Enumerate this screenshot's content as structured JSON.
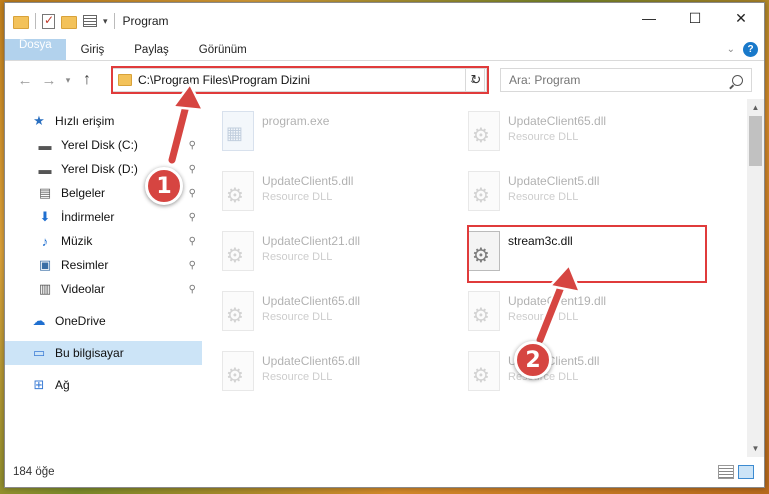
{
  "window": {
    "title": "Program",
    "controls": {
      "minimize": "—",
      "maximize": "☐",
      "close": "✕"
    }
  },
  "ribbon": {
    "tabs": [
      "Dosya",
      "Giriş",
      "Paylaş",
      "Görünüm"
    ],
    "accent": "#1979ca"
  },
  "navigation": {
    "back": "←",
    "forward": "→",
    "up": "↑",
    "address": "C:\\Program Files\\Program Dizini",
    "search_placeholder": "Ara: Program"
  },
  "sidebar": {
    "items": [
      {
        "label": "Hızlı erişim",
        "icon": "star-icon",
        "glyph": "★",
        "pinned": false
      },
      {
        "label": "Yerel Disk (C:)",
        "icon": "drive-icon",
        "glyph": "▬",
        "pinned": true
      },
      {
        "label": "Yerel Disk (D:)",
        "icon": "drive-icon",
        "glyph": "▬",
        "pinned": true
      },
      {
        "label": "Belgeler",
        "icon": "documents-icon",
        "glyph": "▤",
        "pinned": true
      },
      {
        "label": "İndirmeler",
        "icon": "download-icon",
        "glyph": "⬇",
        "pinned": true
      },
      {
        "label": "Müzik",
        "icon": "music-icon",
        "glyph": "♪",
        "pinned": true
      },
      {
        "label": "Resimler",
        "icon": "pictures-icon",
        "glyph": "▣",
        "pinned": true
      },
      {
        "label": "Videolar",
        "icon": "video-icon",
        "glyph": "▥",
        "pinned": true
      },
      {
        "label": "OneDrive",
        "icon": "cloud-icon",
        "glyph": "☁",
        "pinned": false
      },
      {
        "label": "Bu bilgisayar",
        "icon": "computer-icon",
        "glyph": "▭",
        "pinned": false
      },
      {
        "label": "Ağ",
        "icon": "network-icon",
        "glyph": "⊞",
        "pinned": false
      }
    ]
  },
  "files": [
    {
      "name": "program.exe",
      "desc": "",
      "type": "exe"
    },
    {
      "name": "UpdateClient65.dll",
      "desc": "Resource DLL",
      "type": "dll"
    },
    {
      "name": "UpdateClient5.dll",
      "desc": "Resource DLL",
      "type": "dll"
    },
    {
      "name": "UpdateClient5.dll",
      "desc": "Resource DLL",
      "type": "dll"
    },
    {
      "name": "UpdateClient21.dll",
      "desc": "Resource DLL",
      "type": "dll"
    },
    {
      "name": "stream3c.dll",
      "desc": "",
      "type": "dll",
      "highlighted": true
    },
    {
      "name": "UpdateClient65.dll",
      "desc": "Resource DLL",
      "type": "dll"
    },
    {
      "name": "UpdateClient19.dll",
      "desc": "Resource DLL",
      "type": "dll"
    },
    {
      "name": "UpdateClient65.dll",
      "desc": "Resource DLL",
      "type": "dll"
    },
    {
      "name": "UpdateClient5.dll",
      "desc": "Resource DLL",
      "type": "dll"
    }
  ],
  "status": {
    "item_count": "184 öğe"
  },
  "annotations": {
    "step1": "1",
    "step2": "2",
    "color": "#d64541"
  }
}
